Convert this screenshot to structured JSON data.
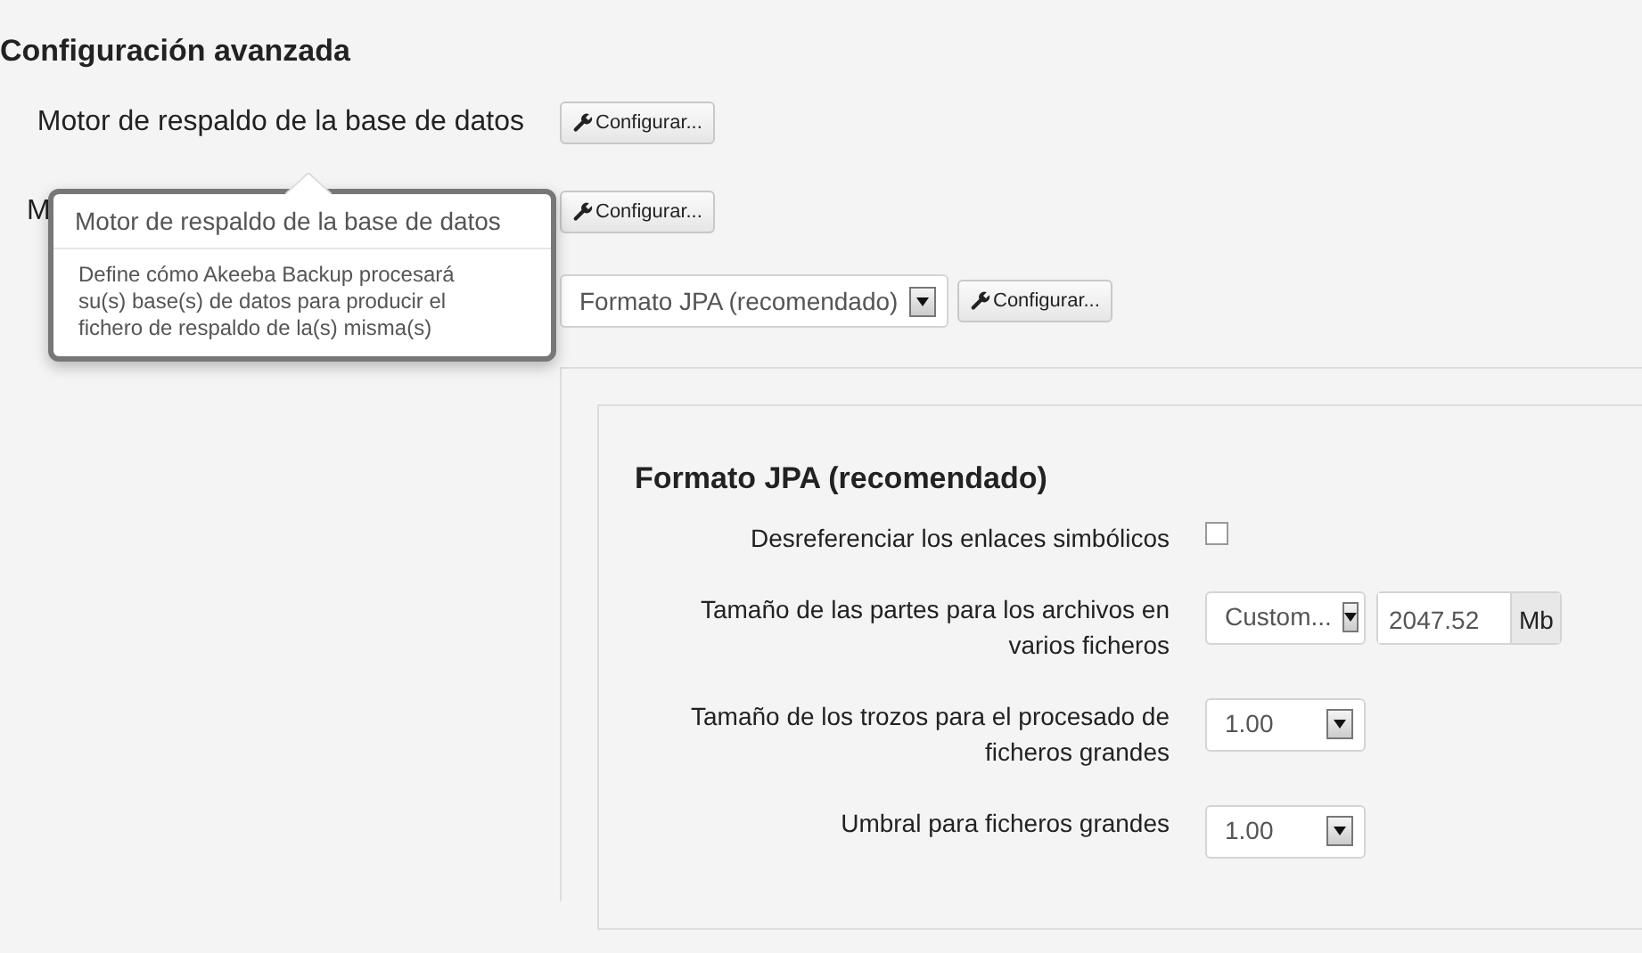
{
  "section_title": "Configuración avanzada",
  "engines": [
    {
      "label": "Motor de respaldo de la base de datos",
      "kind": "button",
      "button": "Configurar..."
    },
    {
      "label": "M",
      "label_covered": true,
      "kind": "button",
      "button": "Configurar..."
    },
    {
      "kind": "select",
      "value": "Formato JPA (recomendado)",
      "button": "Configurar..."
    }
  ],
  "tooltip": {
    "title": "Motor de respaldo de la base de datos",
    "text": "Define cómo Akeeba Backup procesará su(s) base(s) de datos para producir el fichero de respaldo de la(s) misma(s)"
  },
  "panel": {
    "title": "Formato JPA (recomendado)",
    "fields": [
      {
        "label": "Desreferenciar los enlaces simbólicos",
        "kind": "checkbox",
        "checked": false
      },
      {
        "label": "Tamaño de las partes para los archivos en varios ficheros",
        "kind": "select-size",
        "value": "Custom...",
        "size": "2047.52",
        "unit": "Mb"
      },
      {
        "label": "Tamaño de los trozos para el procesado de ficheros grandes",
        "kind": "select",
        "value": "1.00"
      },
      {
        "label": "Umbral para ficheros grandes",
        "kind": "select",
        "value": "1.00"
      }
    ]
  }
}
